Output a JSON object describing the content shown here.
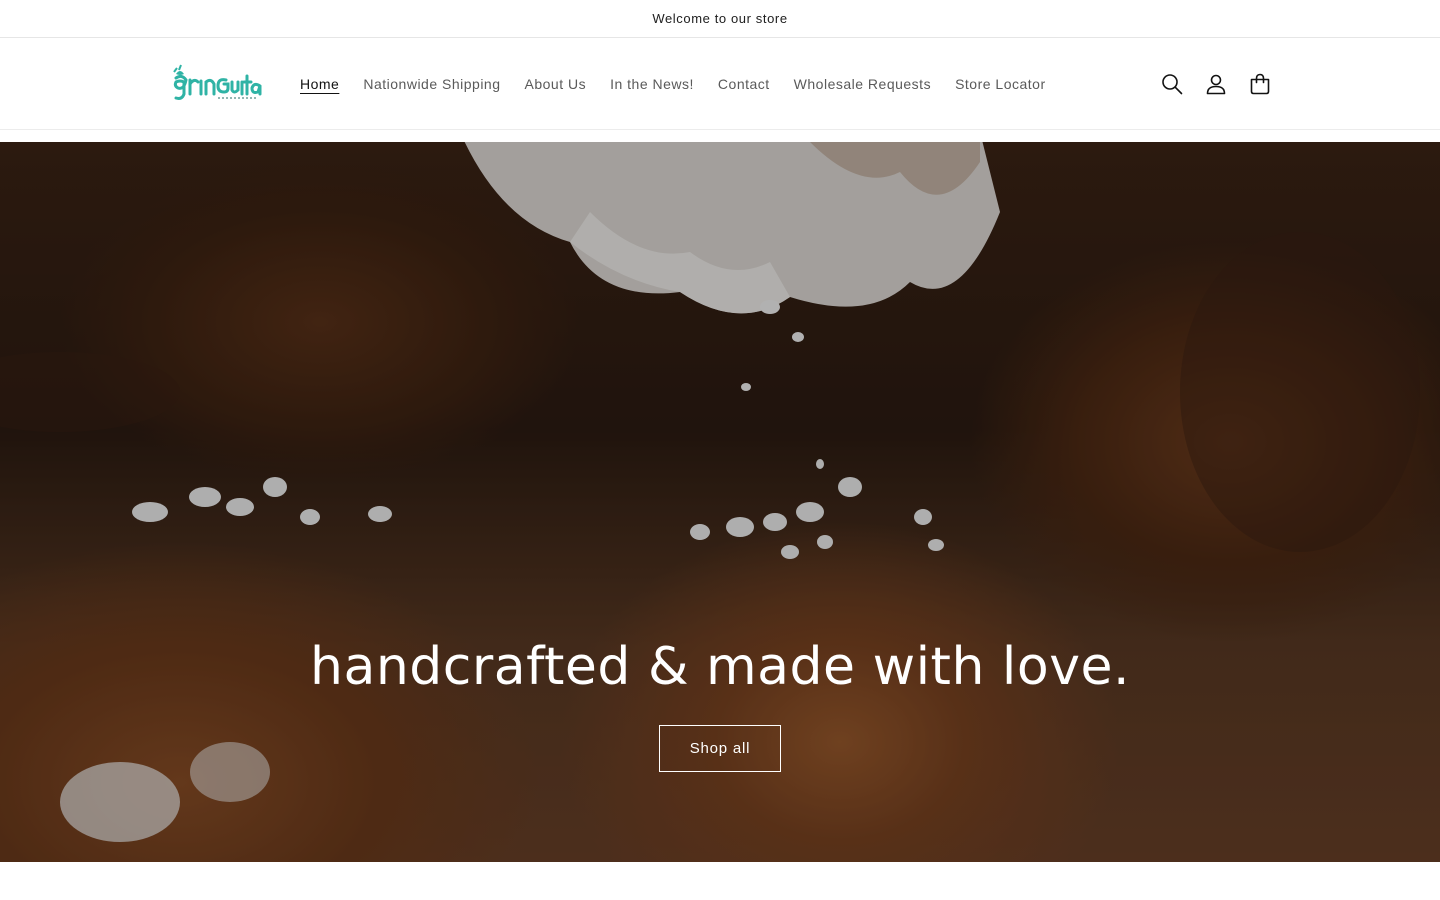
{
  "announcement": {
    "text": "Welcome to our store"
  },
  "header": {
    "logo_alt": "Gringuita",
    "nav": [
      {
        "label": "Home",
        "active": true
      },
      {
        "label": "Nationwide Shipping",
        "active": false
      },
      {
        "label": "About Us",
        "active": false
      },
      {
        "label": "In the News!",
        "active": false
      },
      {
        "label": "Contact",
        "active": false
      },
      {
        "label": "Wholesale Requests",
        "active": false
      },
      {
        "label": "Store Locator",
        "active": false
      }
    ],
    "icons": [
      "search-icon",
      "account-icon",
      "cart-icon"
    ]
  },
  "hero": {
    "title": "handcrafted & made with love.",
    "button_label": "Shop all"
  },
  "colors": {
    "logo_teal": "#2fb3a5",
    "text_dark": "#121212",
    "nav_text": "#5a5a5a"
  }
}
